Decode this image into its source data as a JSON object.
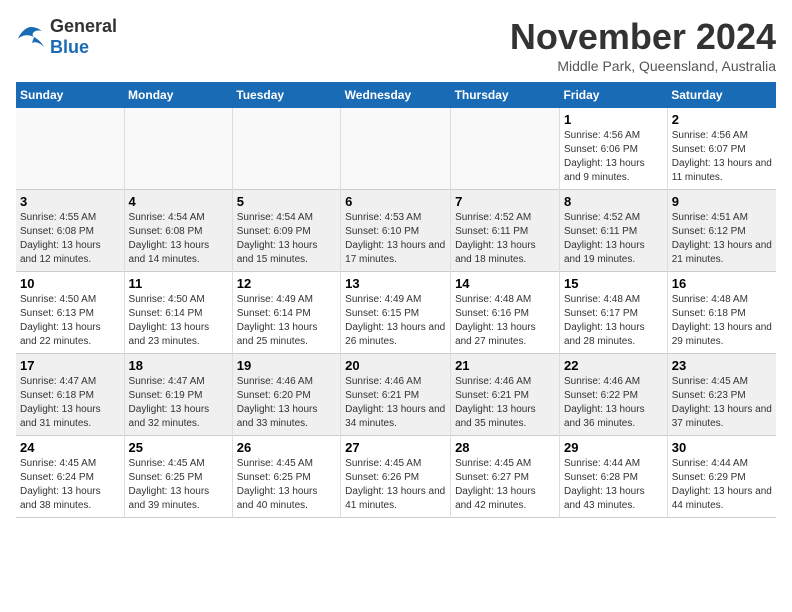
{
  "logo": {
    "general": "General",
    "blue": "Blue"
  },
  "title": "November 2024",
  "location": "Middle Park, Queensland, Australia",
  "weekdays": [
    "Sunday",
    "Monday",
    "Tuesday",
    "Wednesday",
    "Thursday",
    "Friday",
    "Saturday"
  ],
  "weeks": [
    [
      {
        "day": "",
        "info": ""
      },
      {
        "day": "",
        "info": ""
      },
      {
        "day": "",
        "info": ""
      },
      {
        "day": "",
        "info": ""
      },
      {
        "day": "",
        "info": ""
      },
      {
        "day": "1",
        "info": "Sunrise: 4:56 AM\nSunset: 6:06 PM\nDaylight: 13 hours and 9 minutes."
      },
      {
        "day": "2",
        "info": "Sunrise: 4:56 AM\nSunset: 6:07 PM\nDaylight: 13 hours and 11 minutes."
      }
    ],
    [
      {
        "day": "3",
        "info": "Sunrise: 4:55 AM\nSunset: 6:08 PM\nDaylight: 13 hours and 12 minutes."
      },
      {
        "day": "4",
        "info": "Sunrise: 4:54 AM\nSunset: 6:08 PM\nDaylight: 13 hours and 14 minutes."
      },
      {
        "day": "5",
        "info": "Sunrise: 4:54 AM\nSunset: 6:09 PM\nDaylight: 13 hours and 15 minutes."
      },
      {
        "day": "6",
        "info": "Sunrise: 4:53 AM\nSunset: 6:10 PM\nDaylight: 13 hours and 17 minutes."
      },
      {
        "day": "7",
        "info": "Sunrise: 4:52 AM\nSunset: 6:11 PM\nDaylight: 13 hours and 18 minutes."
      },
      {
        "day": "8",
        "info": "Sunrise: 4:52 AM\nSunset: 6:11 PM\nDaylight: 13 hours and 19 minutes."
      },
      {
        "day": "9",
        "info": "Sunrise: 4:51 AM\nSunset: 6:12 PM\nDaylight: 13 hours and 21 minutes."
      }
    ],
    [
      {
        "day": "10",
        "info": "Sunrise: 4:50 AM\nSunset: 6:13 PM\nDaylight: 13 hours and 22 minutes."
      },
      {
        "day": "11",
        "info": "Sunrise: 4:50 AM\nSunset: 6:14 PM\nDaylight: 13 hours and 23 minutes."
      },
      {
        "day": "12",
        "info": "Sunrise: 4:49 AM\nSunset: 6:14 PM\nDaylight: 13 hours and 25 minutes."
      },
      {
        "day": "13",
        "info": "Sunrise: 4:49 AM\nSunset: 6:15 PM\nDaylight: 13 hours and 26 minutes."
      },
      {
        "day": "14",
        "info": "Sunrise: 4:48 AM\nSunset: 6:16 PM\nDaylight: 13 hours and 27 minutes."
      },
      {
        "day": "15",
        "info": "Sunrise: 4:48 AM\nSunset: 6:17 PM\nDaylight: 13 hours and 28 minutes."
      },
      {
        "day": "16",
        "info": "Sunrise: 4:48 AM\nSunset: 6:18 PM\nDaylight: 13 hours and 29 minutes."
      }
    ],
    [
      {
        "day": "17",
        "info": "Sunrise: 4:47 AM\nSunset: 6:18 PM\nDaylight: 13 hours and 31 minutes."
      },
      {
        "day": "18",
        "info": "Sunrise: 4:47 AM\nSunset: 6:19 PM\nDaylight: 13 hours and 32 minutes."
      },
      {
        "day": "19",
        "info": "Sunrise: 4:46 AM\nSunset: 6:20 PM\nDaylight: 13 hours and 33 minutes."
      },
      {
        "day": "20",
        "info": "Sunrise: 4:46 AM\nSunset: 6:21 PM\nDaylight: 13 hours and 34 minutes."
      },
      {
        "day": "21",
        "info": "Sunrise: 4:46 AM\nSunset: 6:21 PM\nDaylight: 13 hours and 35 minutes."
      },
      {
        "day": "22",
        "info": "Sunrise: 4:46 AM\nSunset: 6:22 PM\nDaylight: 13 hours and 36 minutes."
      },
      {
        "day": "23",
        "info": "Sunrise: 4:45 AM\nSunset: 6:23 PM\nDaylight: 13 hours and 37 minutes."
      }
    ],
    [
      {
        "day": "24",
        "info": "Sunrise: 4:45 AM\nSunset: 6:24 PM\nDaylight: 13 hours and 38 minutes."
      },
      {
        "day": "25",
        "info": "Sunrise: 4:45 AM\nSunset: 6:25 PM\nDaylight: 13 hours and 39 minutes."
      },
      {
        "day": "26",
        "info": "Sunrise: 4:45 AM\nSunset: 6:25 PM\nDaylight: 13 hours and 40 minutes."
      },
      {
        "day": "27",
        "info": "Sunrise: 4:45 AM\nSunset: 6:26 PM\nDaylight: 13 hours and 41 minutes."
      },
      {
        "day": "28",
        "info": "Sunrise: 4:45 AM\nSunset: 6:27 PM\nDaylight: 13 hours and 42 minutes."
      },
      {
        "day": "29",
        "info": "Sunrise: 4:44 AM\nSunset: 6:28 PM\nDaylight: 13 hours and 43 minutes."
      },
      {
        "day": "30",
        "info": "Sunrise: 4:44 AM\nSunset: 6:29 PM\nDaylight: 13 hours and 44 minutes."
      }
    ]
  ]
}
